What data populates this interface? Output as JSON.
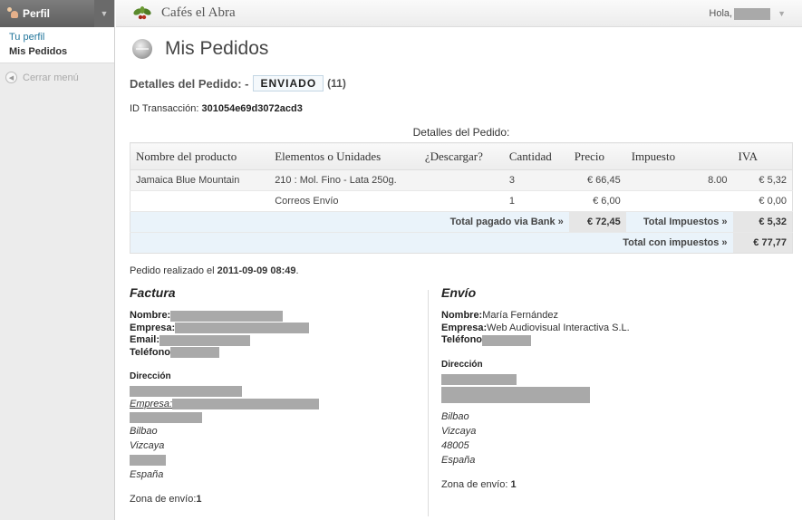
{
  "sidebar": {
    "header_label": "Perfil",
    "items": [
      {
        "label": "Tu perfil"
      },
      {
        "label": "Mis Pedidos"
      }
    ],
    "collapse_label": "Cerrar menú"
  },
  "topbar": {
    "site_title": "Cafés el Abra",
    "greeting": "Hola,"
  },
  "page": {
    "title": "Mis Pedidos"
  },
  "order": {
    "details_label": "Detalles del Pedido: -",
    "status": "ENVIADO",
    "count": "(11)",
    "transaction_label": "ID Transacción:",
    "transaction_id": "301054e69d3072acd3",
    "table_caption": "Detalles del Pedido:",
    "columns": [
      "Nombre del producto",
      "Elementos o Unidades",
      "¿Descargar?",
      "Cantidad",
      "Precio",
      "Impuesto",
      "IVA"
    ],
    "rows": [
      [
        "Jamaica Blue Mountain",
        "210 : Mol. Fino - Lata 250g.",
        "",
        "3",
        "€ 66,45",
        "8.00",
        "€ 5,32"
      ],
      [
        "",
        "Correos Envío",
        "",
        "1",
        "€ 6,00",
        "",
        "€ 0,00"
      ]
    ],
    "totals": {
      "paid_label": "Total pagado via Bank »",
      "paid_value": "€ 72,45",
      "tax_label": "Total Impuestos »",
      "tax_value": "€ 5,32",
      "grand_label": "Total con impuestos »",
      "grand_value": "€ 77,77"
    },
    "placed_label": "Pedido realizado el",
    "placed_date": "2011-09-09 08:49",
    "placed_suffix": "."
  },
  "billing": {
    "title": "Factura",
    "name_label": "Nombre:",
    "company_label": "Empresa:",
    "email_label": "Email:",
    "phone_label": "Teléfono",
    "address_label": "Dirección",
    "company_line_label": "Empresa:",
    "city": "Bilbao",
    "province": "Vizcaya",
    "country": "España",
    "zone_label": "Zona de envío:",
    "zone_value": "1"
  },
  "shipping": {
    "title": "Envío",
    "name_label": "Nombre:",
    "name_value": "María Fernández",
    "company_label": "Empresa:",
    "company_value": "Web Audiovisual Interactiva S.L.",
    "phone_label": "Teléfono",
    "address_label": "Dirección",
    "city": "Bilbao",
    "province": "Vizcaya",
    "postcode": "48005",
    "country": "España",
    "zone_label": "Zona de envío:",
    "zone_value": "1"
  }
}
